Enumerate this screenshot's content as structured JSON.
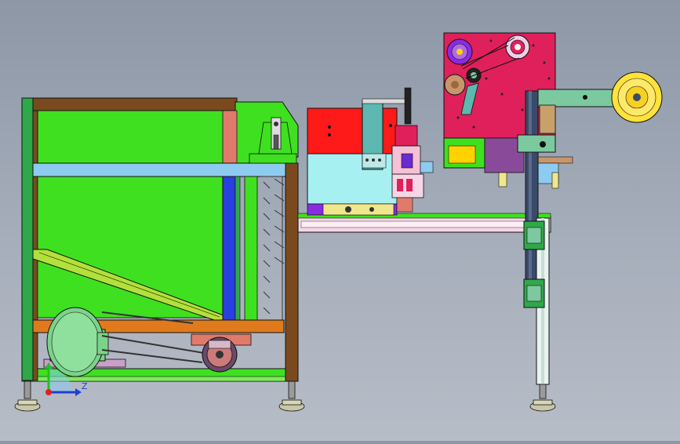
{
  "viewport": {
    "background_top": "#8d97a6",
    "background_bottom": "#b7bdc7"
  },
  "triad": {
    "axis_label": "Z",
    "x_axis_color": "#e02020",
    "y_axis_color": "#1fc21f",
    "z_axis_color": "#1f3fd6"
  },
  "colors": {
    "hopper_green": "#3fe01f",
    "frame_green": "#2fa84a",
    "frame_brown": "#7a4a1e",
    "belt_orange": "#e07a1c",
    "blue_rail": "#2a3fe0",
    "light_blue": "#8ecbf0",
    "red_block": "#ff1a1a",
    "magenta_block": "#e0205a",
    "cyan_block": "#a6f0f2",
    "purple": "#8a2be2",
    "pink_rail": "#f6d6e6",
    "tape_yellow": "#ffe23a",
    "dark_post": "#3a4a6a",
    "arm_green": "#7cc9a0",
    "motor_green": "#7ad38a",
    "gray_foot": "#9a9a9a"
  },
  "icons": {
    "triad": "coordinate-axes-icon",
    "hopper": "hopper-bin-icon",
    "motor": "drive-motor-icon",
    "reel": "tape-reel-icon"
  }
}
